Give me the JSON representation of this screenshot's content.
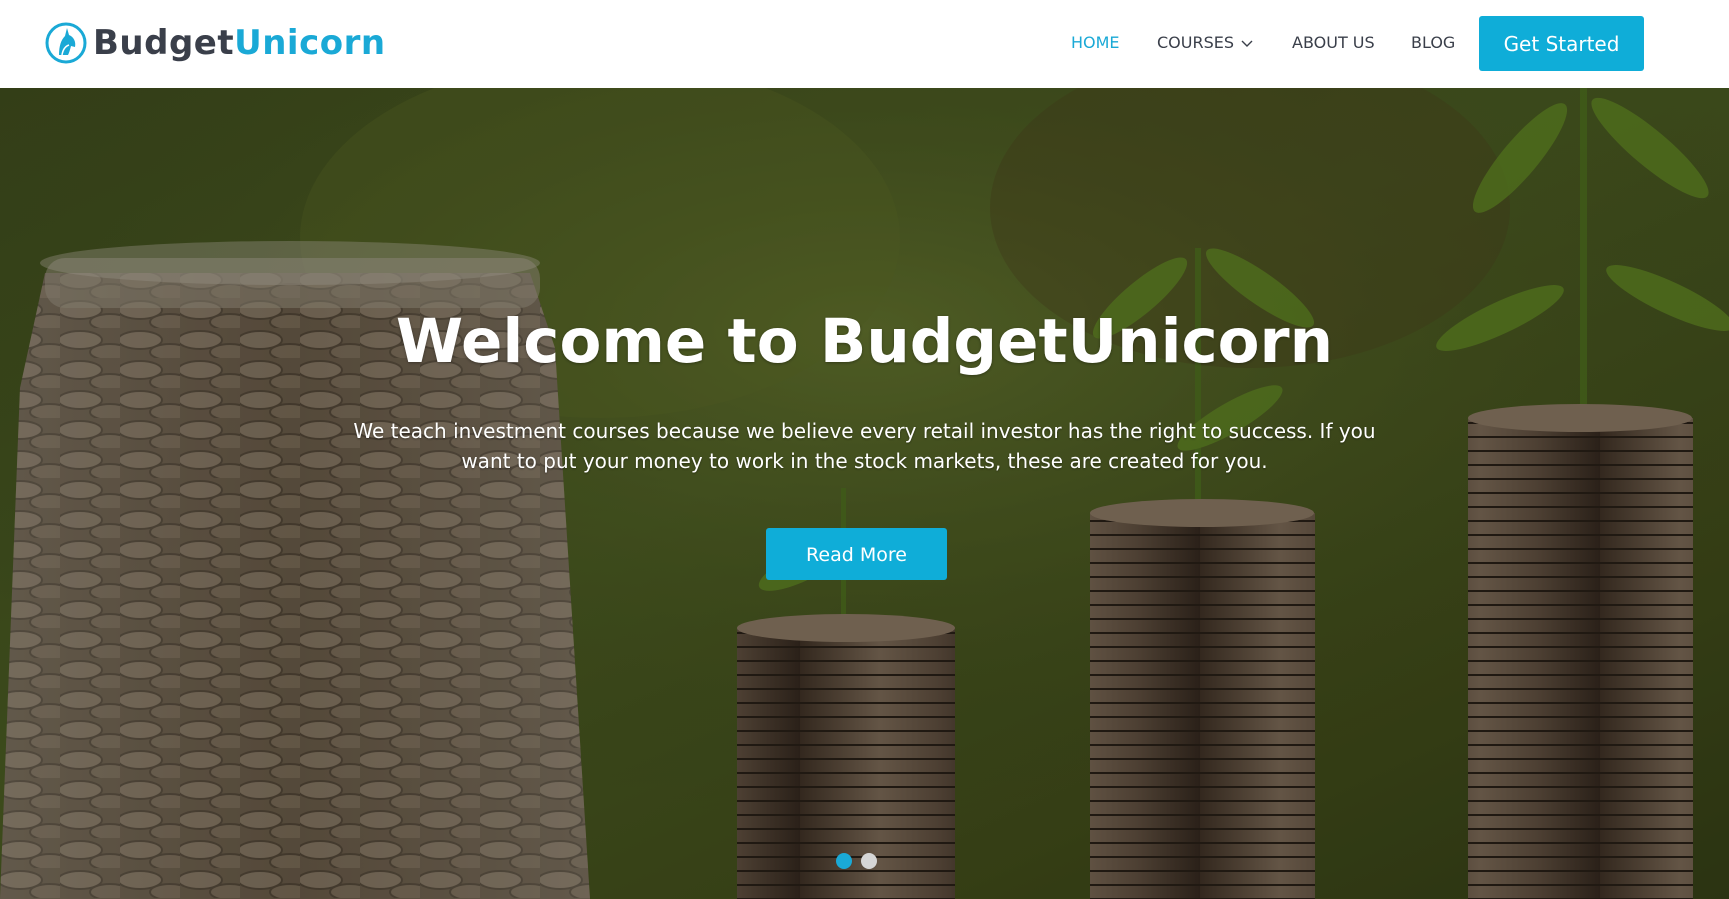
{
  "brand": {
    "name_part1": "Budget",
    "name_part2": "Unicorn",
    "logo_icon": "unicorn-head-icon",
    "colors": {
      "primary": "#1aa9d6",
      "dark_text": "#3a3f4a"
    }
  },
  "nav": {
    "items": [
      {
        "label": "HOME",
        "active": true
      },
      {
        "label": "COURSES",
        "active": false,
        "has_dropdown": true,
        "dropdown_icon": "chevron-down-icon"
      },
      {
        "label": "ABOUT US",
        "active": false
      },
      {
        "label": "BLOG",
        "active": false
      }
    ],
    "cta_label": "Get Started"
  },
  "hero": {
    "title": "Welcome to BudgetUnicorn",
    "subtitle": "We teach investment courses because we believe every retail investor has the right to success. If you want to put your money to work in the stock markets, these are created for you.",
    "button_label": "Read More",
    "background_image": "coins-jar-and-growing-plants-on-coin-stacks",
    "slider": {
      "slide_count": 2,
      "active_index": 0
    }
  }
}
